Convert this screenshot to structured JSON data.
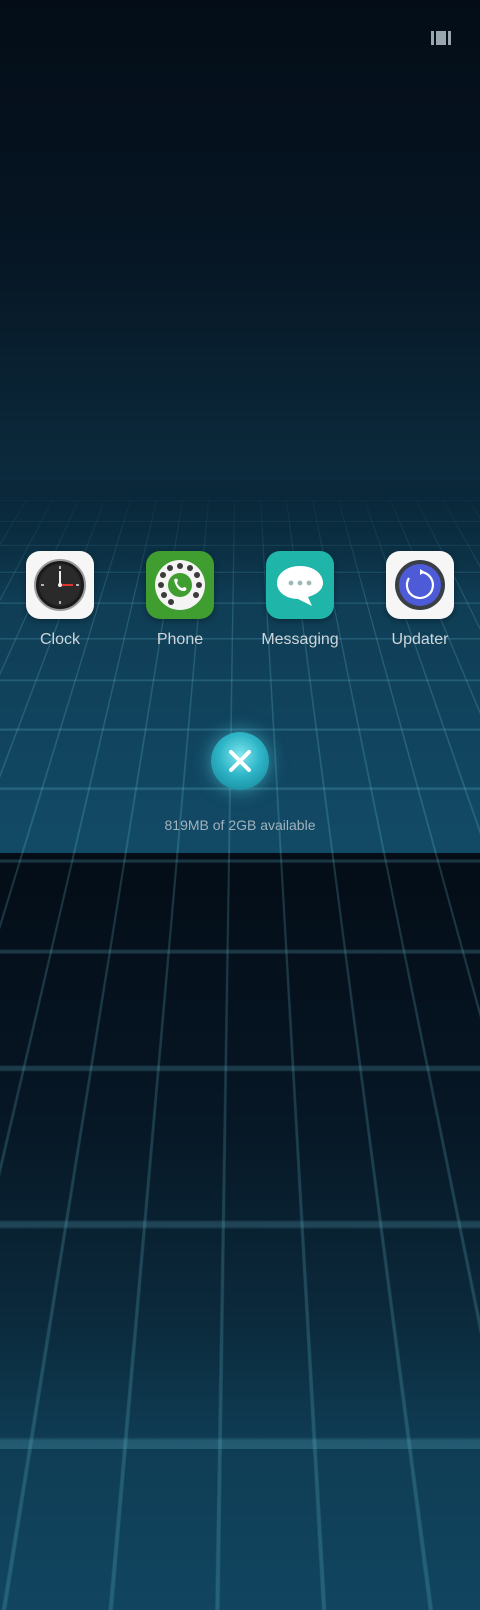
{
  "apps": [
    {
      "label": "Clock",
      "icon": "clock-icon"
    },
    {
      "label": "Phone",
      "icon": "phone-dial-icon"
    },
    {
      "label": "Messaging",
      "icon": "message-bubble-icon"
    },
    {
      "label": "Updater",
      "icon": "updater-icon"
    }
  ],
  "footer": {
    "memory_text": "819MB of 2GB available"
  },
  "colors": {
    "clock_bg": "#ffffff",
    "phone_bg": "#3f9e2f",
    "messaging_bg": "#1fb5a8",
    "updater_bg": "#ffffff",
    "accent": "#2fb6c8"
  }
}
